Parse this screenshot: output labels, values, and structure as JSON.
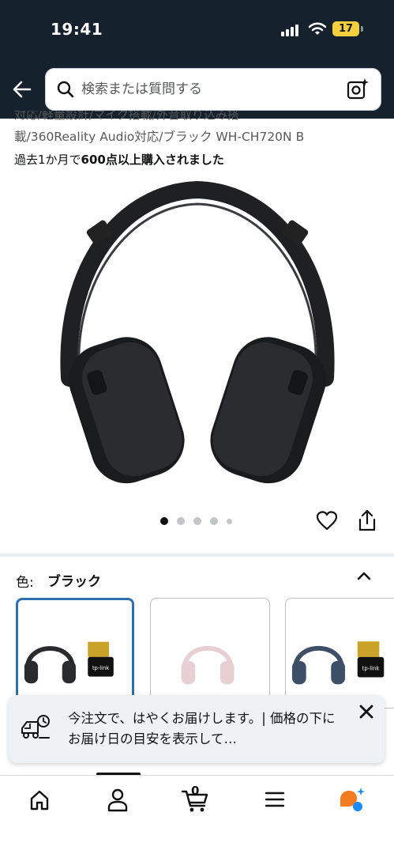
{
  "status_bar": {
    "time": "19:41",
    "battery_level": "17",
    "battery_color": "#f4d03f"
  },
  "header": {
    "background_color": "#16212e",
    "back_icon": "arrow-left-icon",
    "search": {
      "placeholder": "検索または質問する",
      "value": "",
      "icon": "search-icon"
    },
    "camera_icon": "camera-search-icon"
  },
  "product": {
    "title_line1": "対応/軽量設計/マイク搭載/外音取り込み搭",
    "title_line2": "載/360Reality Audio対応/ブラック WH-CH720N B",
    "bought_prefix": "過去1か月で",
    "bought_highlight": "600点以上購入されました",
    "image_alt": "black over-ear headphones",
    "carousel": {
      "total": 5,
      "active_index": 0
    },
    "actions": {
      "favorite_icon": "heart-icon",
      "share_icon": "share-icon"
    }
  },
  "variant": {
    "label": "色:",
    "selected": "ブラック",
    "selection_color": "#2f6fb0",
    "swatches": [
      {
        "name": "black",
        "headphone_color": "#2a2b2d",
        "has_adapter": true,
        "selected": true
      },
      {
        "name": "pink",
        "headphone_color": "#e8cfd3",
        "has_adapter": false,
        "selected": false
      },
      {
        "name": "blue",
        "headphone_color": "#3d4f66",
        "has_adapter": true,
        "selected": false
      }
    ],
    "adapter_label": "tp-link"
  },
  "toast": {
    "message": "今注文で、はやくお届けします。| 価格の下にお届け日の目安を表示して…",
    "icon": "delivery-truck-icon",
    "close_icon": "close-icon"
  },
  "bottom_nav": {
    "items": [
      {
        "name": "home",
        "icon": "home-icon"
      },
      {
        "name": "account",
        "icon": "person-icon"
      },
      {
        "name": "cart",
        "icon": "cart-icon",
        "count": "0"
      },
      {
        "name": "menu",
        "icon": "hamburger-menu-icon"
      },
      {
        "name": "rufus",
        "icon": "assistant-bubble-icon"
      }
    ],
    "active_index": 1
  }
}
